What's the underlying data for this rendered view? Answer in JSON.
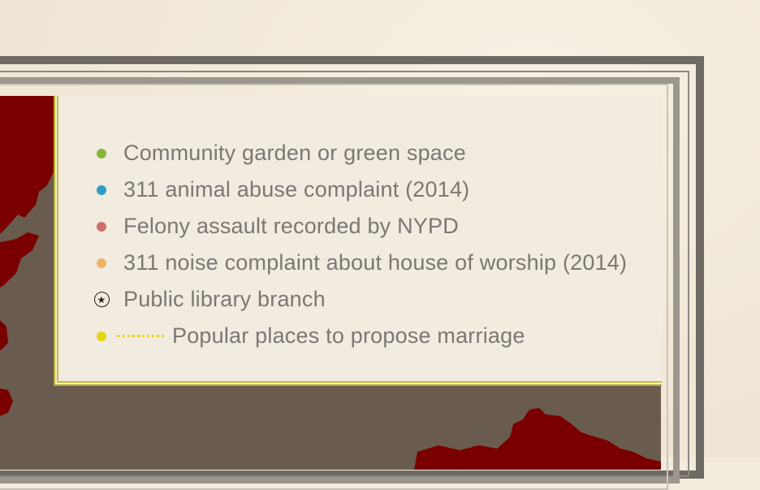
{
  "legend": {
    "items": [
      {
        "label": "Community garden or green space",
        "color": "#86b73c",
        "icon": "green-dot-icon"
      },
      {
        "label": "311 animal abuse complaint (2014)",
        "color": "#2f9dc4",
        "icon": "blue-dot-icon"
      },
      {
        "label": "Felony assault recorded by NYPD",
        "color": "#d0706a",
        "icon": "red-dot-icon"
      },
      {
        "label": "311 noise complaint about house of worship (2014)",
        "color": "#efb266",
        "icon": "orange-dot-icon"
      },
      {
        "label": "Public library branch",
        "color": "#222222",
        "icon": "star-circle-icon"
      },
      {
        "label": "Popular places to propose marriage",
        "color": "#e3d60f",
        "icon": "yellow-dot-dotted-line-icon"
      }
    ]
  },
  "colors": {
    "land": "#7a0000",
    "water": "#6a5b4f",
    "frame": "#6e6a63",
    "legend_border": "#c9be2e"
  }
}
